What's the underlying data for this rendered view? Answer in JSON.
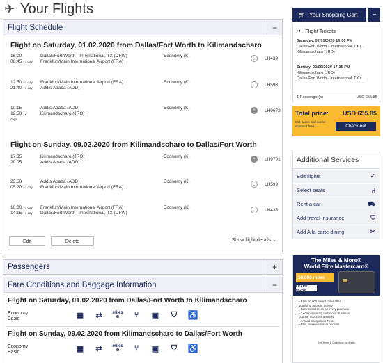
{
  "page": {
    "title": "Your Flights"
  },
  "schedule": {
    "header": "Flight Schedule",
    "toggle": "−",
    "flights": [
      {
        "heading": "Flight on Saturday, 01.02.2020 from Dallas/Fort Worth to Kilimandscharo",
        "segments": [
          {
            "dep_time": "16:00",
            "arr_time": "08:45",
            "arr_plus": "+1 day",
            "dep_place": "Dallas/Fort Worth - International, TX (DFW)",
            "arr_place": "Frankfurt/Main International Airport (FRA)",
            "cls": "Economy (K)",
            "flight": "LH439",
            "icon": "chevron-down"
          },
          {
            "dep_time": "12:50",
            "dep_plus": "+1 day",
            "arr_time": "21:40",
            "arr_plus": "+1 day",
            "dep_place": "Frankfurt/Main International Airport (FRA)",
            "arr_place": "Addis Ababa (ADD)",
            "cls": "Economy (K)",
            "flight": "LH598",
            "icon": "chevron-down"
          },
          {
            "dep_time": "10:15",
            "arr_time": "12:50",
            "arr_plus": "+2 days",
            "dep_place": "Addis Ababa (ADD)",
            "arr_place": "Kilimandscharo (JRO)",
            "cls": "Economy (K)",
            "flight": "LH9672",
            "icon": "plus"
          }
        ]
      },
      {
        "heading": "Flight on Sunday, 09.02.2020 from Kilimandscharo to Dallas/Fort Worth",
        "segments": [
          {
            "dep_time": "17:35",
            "arr_time": "20:05",
            "dep_place": "Kilimandscharo (JRO)",
            "arr_place": "Addis Ababa (ADD)",
            "cls": "Economy (K)",
            "flight": "LH9701",
            "icon": "plus"
          },
          {
            "dep_time": "23:50",
            "arr_time": "05:20",
            "arr_plus": "+1 day",
            "dep_place": "Addis Ababa (ADD)",
            "arr_place": "Frankfurt/Main International Airport (FRA)",
            "cls": "Economy (K)",
            "flight": "LH599",
            "icon": "chevron-down"
          },
          {
            "dep_time": "10:00",
            "dep_plus": "+1 day",
            "arr_time": "14:15",
            "arr_plus": "+1 day",
            "dep_place": "Frankfurt/Main International Airport (FRA)",
            "arr_place": "Dallas/Fort Worth - International, TX (DFW)",
            "cls": "Economy (K)",
            "flight": "LH438",
            "icon": "chevron-down"
          }
        ]
      }
    ],
    "edit_label": "Edit",
    "delete_label": "Delete",
    "show_details": "Show flight details ⌄"
  },
  "passengers": {
    "header": "Passengers",
    "toggle": "+"
  },
  "fare": {
    "header": "Fare Conditions and Baggage Information",
    "toggle": "−",
    "rows": [
      {
        "heading": "Flight on Saturday, 01.02.2020 from Dallas/Fort Worth to Kilimandscharo",
        "cls1": "Economy",
        "cls2": "Basic"
      },
      {
        "heading": "Flight on Sunday, 09.02.2020 from Kilimandscharo to Dallas/Fort Worth",
        "cls1": "Economy",
        "cls2": "Basic"
      }
    ],
    "icons": [
      "seat-reservation-icon",
      "rebooking-icon",
      "miles-icon",
      "meal-icon",
      "baggage-icon",
      "lounge-icon",
      "accessibility-icon"
    ]
  },
  "cart": {
    "label": "Your Shopping Cart",
    "toggle": "−",
    "tickets_title": "Flight Tickets",
    "tickets": [
      {
        "date": "Saturday, 02/01/2020 16:00 PM",
        "from": "Dallas/Fort Worth - International, TX (...",
        "to": "Kilimandscharo (JRO)"
      },
      {
        "date": "Sunday, 02/09/2020 17:35 PM",
        "from": "Kilimandscharo (JRO)",
        "to": "Dallas/Fort Worth - International, TX (..."
      }
    ],
    "passengers": "1 Passenger(s)",
    "passengers_price": "USD 655.85",
    "total_label": "Total price:",
    "total_value": "USD 655.85",
    "total_note": "Incl. taxes and carrier imposed fees",
    "checkout": "Check-out"
  },
  "services": {
    "title": "Additional Services",
    "items": [
      {
        "label": "Edit flights",
        "icon": "✓"
      },
      {
        "label": "Select seats",
        "icon": "⑁"
      },
      {
        "label": "Rent a car",
        "icon": "⛟"
      },
      {
        "label": "Add travel insurance",
        "icon": "⛉"
      },
      {
        "label": "Add A la carte dining",
        "icon": "✂"
      }
    ]
  },
  "ad": {
    "title1": "The Miles & More®",
    "title2": "World Elite Mastercard®",
    "miles": "50,000 miles",
    "learn": "LEARN MORE",
    "bullets": [
      "• Earn 50,000 award miles after",
      "  qualifying account activity",
      "• Earn award miles on every purchase",
      "• 2 complimentary Lufthansa Business",
      "  Lounge Vouchers annually",
      "• Annual Companion Ticket",
      "• Plus, more exclusive benefits"
    ],
    "fine": "See Terms & Conditions for details"
  },
  "colors": {
    "brand": "#1c2a5b",
    "accent": "#f9ba2f",
    "panel_header": "#eef0f5"
  }
}
